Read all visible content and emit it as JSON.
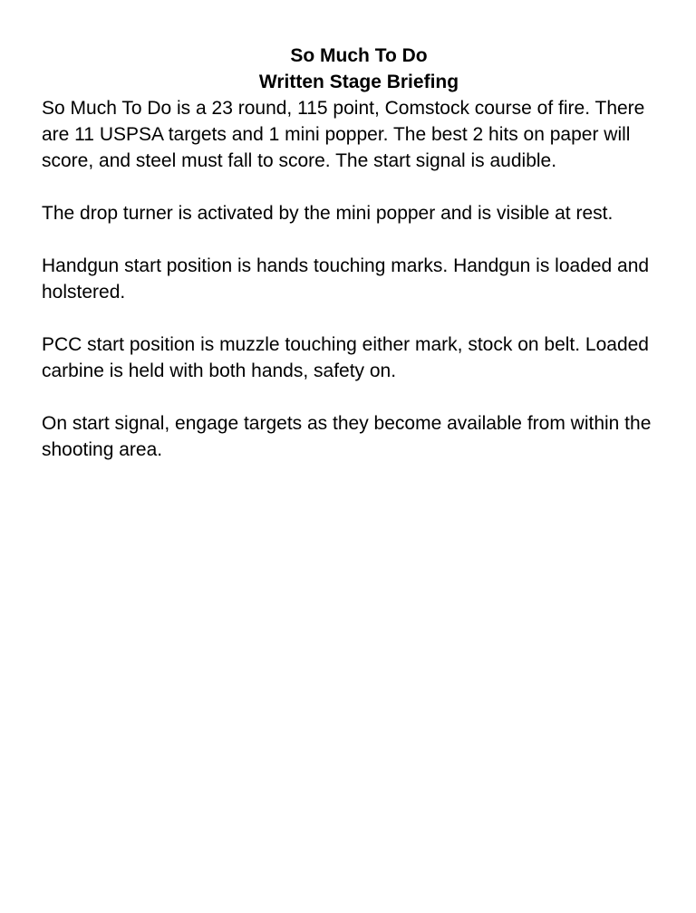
{
  "document": {
    "title": "So Much To Do",
    "subtitle": "Written Stage Briefing",
    "paragraphs": [
      "So Much To Do is a 23 round, 115 point, Comstock course of fire. There are 11 USPSA targets and 1 mini popper. The best 2 hits on paper will score, and steel must fall to score. The start signal is audible.",
      "The drop turner is activated by the mini popper and is visible at rest.",
      "Handgun start position is hands touching marks. Handgun is loaded and holstered.",
      "PCC start position is muzzle touching either mark, stock on belt. Loaded carbine is held with both hands, safety on.",
      "On start signal, engage targets as they become available from within the shooting area."
    ]
  }
}
